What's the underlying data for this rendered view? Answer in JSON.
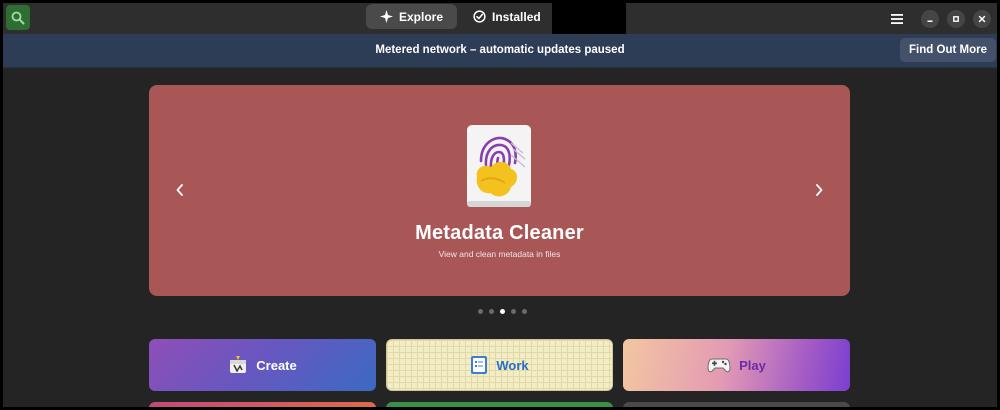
{
  "header": {
    "tabs": [
      {
        "label": "Explore",
        "icon": "explore-icon",
        "active": true
      },
      {
        "label": "Installed",
        "icon": "installed-check-icon",
        "active": false
      }
    ]
  },
  "banner": {
    "text": "Metered network – automatic updates paused",
    "button_label": "Find Out More"
  },
  "featured": {
    "title": "Metadata Cleaner",
    "subtitle": "View and clean metadata in files",
    "background": "#a85656",
    "page_count": 5,
    "active_page": 3
  },
  "categories": [
    {
      "label": "Create",
      "icon": "create-icon"
    },
    {
      "label": "Work",
      "icon": "work-icon"
    },
    {
      "label": "Play",
      "icon": "gamepad-icon"
    }
  ],
  "colors": {
    "accent": "#2f6e33",
    "banner": "#2e3d56",
    "window": "#242424"
  }
}
